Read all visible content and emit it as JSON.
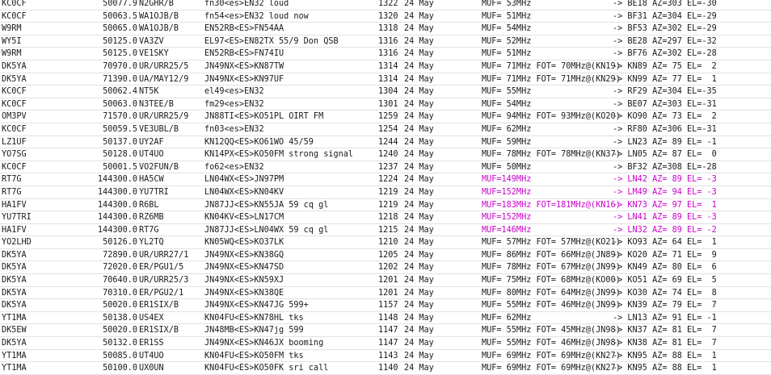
{
  "colors": {
    "background": "#ffffff",
    "text": "#1a1a1a",
    "highlight": "#cc00cc",
    "row_divider": "#e2e2e2"
  },
  "spots": [
    {
      "spotter": "KC0CF",
      "freq": "50077.9",
      "dx": "N2GHR/B",
      "comment": "fn30<es>EN32 loud",
      "time": "1322",
      "date": "24 May",
      "prop": "MUF= 53MHz",
      "path": "-> BE18 AZ=303 EL=-30",
      "hi": false
    },
    {
      "spotter": "KC0CF",
      "freq": "50063.5",
      "dx": "WA1OJB/B",
      "comment": "fn54<es>EN32 loud now",
      "time": "1320",
      "date": "24 May",
      "prop": "MUF= 51MHz",
      "path": "-> BF31 AZ=304 EL=-29",
      "hi": false
    },
    {
      "spotter": "W9RM",
      "freq": "50065.0",
      "dx": "WA1OJB/B",
      "comment": "EN52RB<ES>FN54AA",
      "time": "1318",
      "date": "24 May",
      "prop": "MUF= 54MHz",
      "path": "-> BF53 AZ=302 EL=-29",
      "hi": false
    },
    {
      "spotter": "WY5I",
      "freq": "50125.0",
      "dx": "VA3ZV",
      "comment": "EL97<ES>EN82TX 55/9 Don QSB",
      "time": "1316",
      "date": "24 May",
      "prop": "MUF= 52MHz",
      "path": "-> BE28 AZ=297 EL=-32",
      "hi": false
    },
    {
      "spotter": "W9RM",
      "freq": "50125.0",
      "dx": "VE1SKY",
      "comment": "EN52RB<ES>FN74IU",
      "time": "1316",
      "date": "24 May",
      "prop": "MUF= 51MHz",
      "path": "-> BF76 AZ=302 EL=-28",
      "hi": false
    },
    {
      "spotter": "DK5YA",
      "freq": "70970.0",
      "dx": "UR/URR25/5",
      "comment": "JN49NX<ES>KN87TW",
      "time": "1314",
      "date": "24 May",
      "prop": "MUF= 71MHz FOT= 70MHz@(KN19)",
      "path": "-> KN89 AZ= 75 EL=  2",
      "hi": false
    },
    {
      "spotter": "DK5YA",
      "freq": "71390.0",
      "dx": "UA/MAY12/9",
      "comment": "JN49NX<ES>KN97UF",
      "time": "1314",
      "date": "24 May",
      "prop": "MUF= 71MHz FOT= 71MHz@(KN29)",
      "path": "-> KN99 AZ= 77 EL=  1",
      "hi": false
    },
    {
      "spotter": "KC0CF",
      "freq": "50062.4",
      "dx": "NT5K",
      "comment": "el49<es>EN32",
      "time": "1304",
      "date": "24 May",
      "prop": "MUF= 55MHz",
      "path": "-> RF29 AZ=304 EL=-35",
      "hi": false
    },
    {
      "spotter": "KC0CF",
      "freq": "50063.0",
      "dx": "N3TEE/B",
      "comment": "fm29<es>EN32",
      "time": "1301",
      "date": "24 May",
      "prop": "MUF= 54MHz",
      "path": "-> BE07 AZ=303 EL=-31",
      "hi": false
    },
    {
      "spotter": "OM3PV",
      "freq": "71570.0",
      "dx": "UR/URR25/9",
      "comment": "JN88TI<ES>KO51PL OIRT FM",
      "time": "1259",
      "date": "24 May",
      "prop": "MUF= 94MHz FOT= 93MHz@(KO20)",
      "path": "-> KO90 AZ= 73 EL=  2",
      "hi": false
    },
    {
      "spotter": "KC0CF",
      "freq": "50059.5",
      "dx": "VE3UBL/B",
      "comment": "fn03<es>EN32",
      "time": "1254",
      "date": "24 May",
      "prop": "MUF= 62MHz",
      "path": "-> RF80 AZ=306 EL=-31",
      "hi": false
    },
    {
      "spotter": "LZ1UF",
      "freq": "50137.0",
      "dx": "UY2AF",
      "comment": "KN12QQ<ES>KO61WO 45/59",
      "time": "1244",
      "date": "24 May",
      "prop": "MUF= 59MHz",
      "path": "-> LN23 AZ= 89 EL= -1",
      "hi": false
    },
    {
      "spotter": "YO7SG",
      "freq": "50128.0",
      "dx": "UT4UO",
      "comment": "KN14PX<ES>KO50FM strong signal",
      "time": "1240",
      "date": "24 May",
      "prop": "MUF= 78MHz FOT= 78MHz@(KN37)",
      "path": "-> LN05 AZ= 87 EL=  0",
      "hi": false
    },
    {
      "spotter": "KC0CF",
      "freq": "50001.5",
      "dx": "VO2FUN/B",
      "comment": "fo62<es>EN32",
      "time": "1237",
      "date": "24 May",
      "prop": "MUF= 50MHz",
      "path": "-> BF32 AZ=308 EL=-28",
      "hi": false
    },
    {
      "spotter": "RT7G",
      "freq": "144300.0",
      "dx": "HA5CW",
      "comment": "LN04WX<ES>JN97PM",
      "time": "1224",
      "date": "24 May",
      "prop": "MUF=149MHz",
      "path": "-> LN42 AZ= 89 EL= -3",
      "hi": true
    },
    {
      "spotter": "RT7G",
      "freq": "144300.0",
      "dx": "YU7TRI",
      "comment": "LN04WX<ES>KN04KV",
      "time": "1219",
      "date": "24 May",
      "prop": "MUF=152MHz",
      "path": "-> LM49 AZ= 94 EL= -3",
      "hi": true
    },
    {
      "spotter": "HA1FV",
      "freq": "144300.0",
      "dx": "R6BL",
      "comment": "JN87JJ<ES>KN55JA 59 cq gl",
      "time": "1219",
      "date": "24 May",
      "prop": "MUF=183MHz FOT=181MHz@(KN16)",
      "path": "-> KN73 AZ= 97 EL=  1",
      "hi": true
    },
    {
      "spotter": "YU7TRI",
      "freq": "144300.0",
      "dx": "RZ6MB",
      "comment": "KN04KV<ES>LN17CM",
      "time": "1218",
      "date": "24 May",
      "prop": "MUF=152MHz",
      "path": "-> LN41 AZ= 89 EL= -3",
      "hi": true
    },
    {
      "spotter": "HA1FV",
      "freq": "144300.0",
      "dx": "RT7G",
      "comment": "JN87JJ<ES>LN04WX 59 cq gl",
      "time": "1215",
      "date": "24 May",
      "prop": "MUF=146MHz",
      "path": "-> LN32 AZ= 89 EL= -2",
      "hi": true
    },
    {
      "spotter": "YO2LHD",
      "freq": "50126.0",
      "dx": "YL2TQ",
      "comment": "KN05WQ<ES>KO37LK",
      "time": "1210",
      "date": "24 May",
      "prop": "MUF= 57MHz FOT= 57MHz@(KO21)",
      "path": "-> KO93 AZ= 64 EL=  1",
      "hi": false
    },
    {
      "spotter": "DK5YA",
      "freq": "72890.0",
      "dx": "UR/URR27/1",
      "comment": "JN49NX<ES>KN38GQ",
      "time": "1205",
      "date": "24 May",
      "prop": "MUF= 86MHz FOT= 66MHz@(JN89)",
      "path": "-> KO20 AZ= 71 EL=  9",
      "hi": false
    },
    {
      "spotter": "DK5YA",
      "freq": "72020.0",
      "dx": "ER/PGU1/5",
      "comment": "JN49NX<ES>KN47SD",
      "time": "1202",
      "date": "24 May",
      "prop": "MUF= 78MHz FOT= 67MHz@(JN99)",
      "path": "-> KN49 AZ= 80 EL=  6",
      "hi": false
    },
    {
      "spotter": "DK5YA",
      "freq": "70640.0",
      "dx": "UR/URR25/3",
      "comment": "JN49NX<ES>KN59XJ",
      "time": "1201",
      "date": "24 May",
      "prop": "MUF= 75MHz FOT= 68MHz@(KO00)",
      "path": "-> KO51 AZ= 69 EL=  5",
      "hi": false
    },
    {
      "spotter": "DK5YA",
      "freq": "70310.0",
      "dx": "ER/PGU2/1",
      "comment": "JN49NX<ES>KN38QE",
      "time": "1201",
      "date": "24 May",
      "prop": "MUF= 80MHz FOT= 64MHz@(JN99)",
      "path": "-> KO30 AZ= 74 EL=  8",
      "hi": false
    },
    {
      "spotter": "DK5YA",
      "freq": "50020.0",
      "dx": "ER1SIX/B",
      "comment": "JN49NX<ES>KN47JG 599+",
      "time": "1157",
      "date": "24 May",
      "prop": "MUF= 55MHz FOT= 46MHz@(JN99)",
      "path": "-> KN39 AZ= 79 EL=  7",
      "hi": false
    },
    {
      "spotter": "YT1MA",
      "freq": "50138.0",
      "dx": "US4EX",
      "comment": "KN04FU<ES>KN78HL tks",
      "time": "1148",
      "date": "24 May",
      "prop": "MUF= 62MHz",
      "path": "-> LN13 AZ= 91 EL= -1",
      "hi": false
    },
    {
      "spotter": "DK5EW",
      "freq": "50020.0",
      "dx": "ER1SIX/B",
      "comment": "JN48MB<ES>KN47jg 599",
      "time": "1147",
      "date": "24 May",
      "prop": "MUF= 55MHz FOT= 45MHz@(JN98)",
      "path": "-> KN37 AZ= 81 EL=  7",
      "hi": false
    },
    {
      "spotter": "DK5YA",
      "freq": "50132.0",
      "dx": "ER1SS",
      "comment": "JN49NX<ES>KN46JX booming",
      "time": "1147",
      "date": "24 May",
      "prop": "MUF= 55MHz FOT= 46MHz@(JN98)",
      "path": "-> KN38 AZ= 81 EL=  7",
      "hi": false
    },
    {
      "spotter": "YT1MA",
      "freq": "50085.0",
      "dx": "UT4UO",
      "comment": "KN04FU<ES>KO50FM tks",
      "time": "1143",
      "date": "24 May",
      "prop": "MUF= 69MHz FOT= 69MHz@(KN27)",
      "path": "-> KN95 AZ= 88 EL=  1",
      "hi": false
    },
    {
      "spotter": "YT1MA",
      "freq": "50100.0",
      "dx": "UX0UN",
      "comment": "KN04FU<ES>KO50FK sri call",
      "time": "1140",
      "date": "24 May",
      "prop": "MUF= 69MHz FOT= 69MHz@(KN27)",
      "path": "-> KN95 AZ= 88 EL=  1",
      "hi": false
    }
  ]
}
